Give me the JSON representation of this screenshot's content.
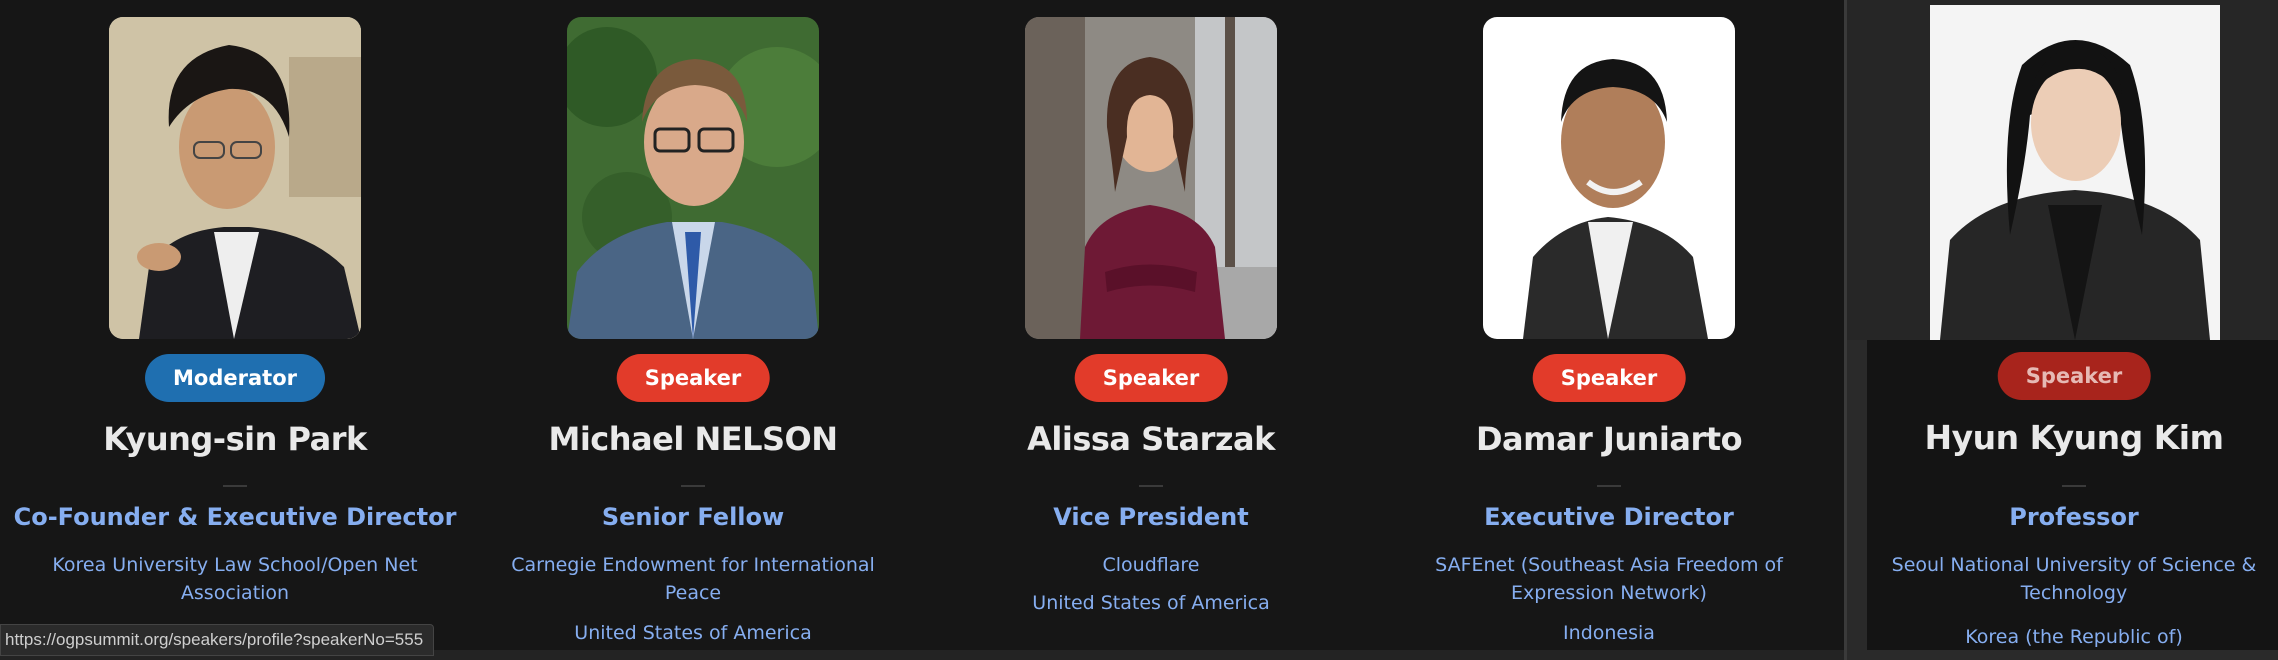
{
  "colors": {
    "background": "#161616",
    "moderator_badge": "#1f6fb0",
    "speaker_badge": "#e23b2a",
    "name_text": "#e9e9e9",
    "accent_text": "#86aef0"
  },
  "speakers": [
    {
      "role": "Moderator",
      "name": "Kyung-sin Park",
      "title": "Co-Founder & Executive Director",
      "org": "Korea University Law School/Open Net Association",
      "country": ""
    },
    {
      "role": "Speaker",
      "name": "Michael NELSON",
      "title": "Senior Fellow",
      "org": "Carnegie Endowment for International Peace",
      "country": "United States of America"
    },
    {
      "role": "Speaker",
      "name": "Alissa Starzak",
      "title": "Vice President",
      "org": "Cloudflare",
      "country": "United States of America"
    },
    {
      "role": "Speaker",
      "name": "Damar Juniarto",
      "title": "Executive Director",
      "org": "SAFEnet (Southeast Asia Freedom of Expression Network)",
      "country": "Indonesia"
    }
  ],
  "side_speaker": {
    "role": "Speaker",
    "name": "Hyun Kyung Kim",
    "title": "Professor",
    "org": "Seoul National University of Science & Technology",
    "country": "Korea (the Republic of)"
  },
  "status_url": "https://ogpsummit.org/speakers/profile?speakerNo=555"
}
